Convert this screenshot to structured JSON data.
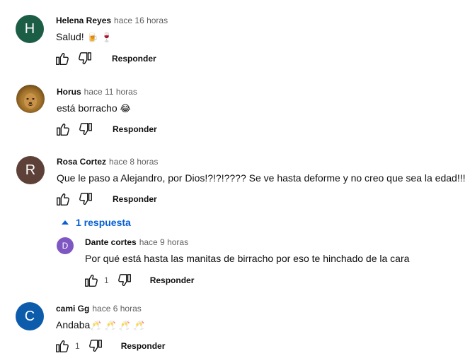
{
  "comments": [
    {
      "author": "Helena Reyes",
      "time": "hace 16 horas",
      "text": "Salud!",
      "emoji": "🍺 🍷",
      "avatar_letter": "H",
      "avatar_color": "#1b5e45",
      "likes": "",
      "reply_label": "Responder"
    },
    {
      "author": "Horus",
      "time": "hace 11 horas",
      "text": "está borracho",
      "emoji": "😂",
      "avatar_letter": "",
      "avatar_color": "#a7772c",
      "likes": "",
      "reply_label": "Responder"
    },
    {
      "author": "Rosa Cortez",
      "time": "hace 8 horas",
      "text": "Que le paso a Alejandro, por Dios!?!?!???? Se ve hasta deforme y no creo que sea la edad!!!",
      "avatar_letter": "R",
      "avatar_color": "#5d4037",
      "likes": "",
      "reply_label": "Responder",
      "replies_toggle": "1 respuesta",
      "reply": {
        "author": "Dante cortes",
        "time": "hace 9 horas",
        "text": "Por qué está hasta las manitas de birracho por eso te hinchado de la cara",
        "avatar_letter": "D",
        "avatar_color": "#7e57c2",
        "likes": "1",
        "reply_label": "Responder"
      }
    },
    {
      "author": "cami Gg",
      "time": "hace 6 horas",
      "text": "Andaba",
      "emoji": "🥂 🥂 🥂 🥂",
      "avatar_letter": "C",
      "avatar_color": "#0d5bab",
      "likes": "1",
      "reply_label": "Responder"
    }
  ]
}
